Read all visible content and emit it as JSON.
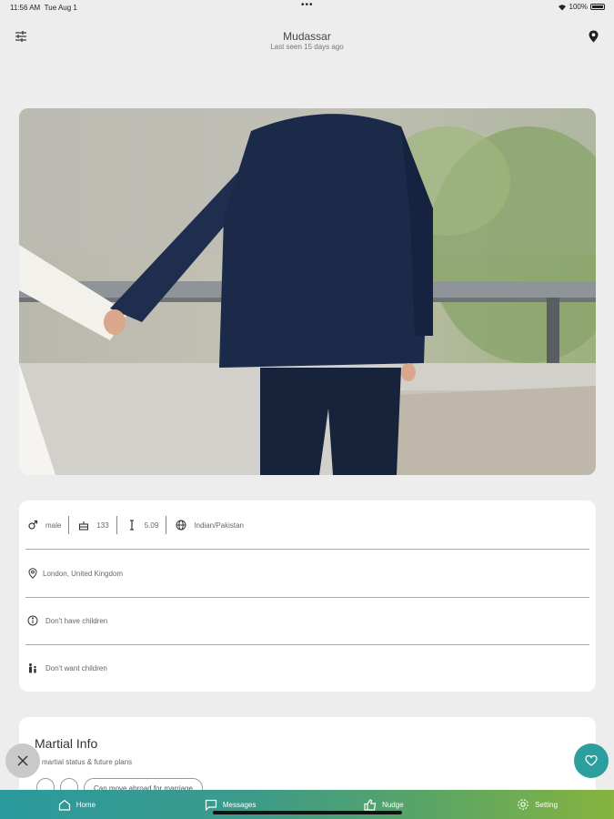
{
  "status_bar": {
    "time": "11:56 AM",
    "date": "Tue Aug 1",
    "battery": "100%"
  },
  "header": {
    "name": "Mudassar",
    "last_seen": "Last seen 15 days ago"
  },
  "profile_photo": {
    "alt": "couple holding hands photo"
  },
  "details": {
    "gender": "male",
    "age": "133",
    "height": "5.09",
    "ethnicity": "Indian/Pakistan",
    "location": "London, United Kingdom",
    "has_children": "Don't have children",
    "want_children": "Don't want children"
  },
  "marital": {
    "heading": "Martial Info",
    "description": "is martial status & future plans",
    "chip": "Can move abroad for marriage"
  },
  "nav": {
    "items": [
      {
        "label": "Home",
        "icon": "home-icon"
      },
      {
        "label": "Messages",
        "icon": "message-icon"
      },
      {
        "label": "Nudge",
        "icon": "thumbs-up-icon"
      },
      {
        "label": "Setting",
        "icon": "gear-icon"
      }
    ]
  },
  "colors": {
    "accent": "#2a9f9d",
    "nav_start": "#2a9a9d",
    "nav_end": "#86b33e"
  }
}
